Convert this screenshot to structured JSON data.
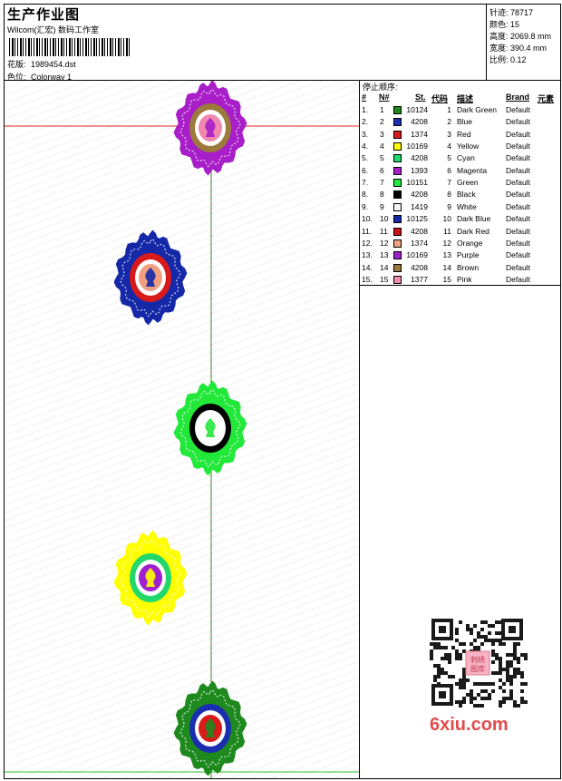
{
  "header": {
    "title": "生产作业图",
    "company": "Wilcom(汇宏) 数码工作室",
    "design_label": "花版:",
    "design_value": "1989454.dst",
    "color_label": "色位:",
    "color_value": "Colorway 1"
  },
  "stats": {
    "stitches_label": "针迹:",
    "stitches": "78717",
    "colors_label": "颜色:",
    "colors": "15",
    "height_label": "高度:",
    "height": "2069.8 mm",
    "width_label": "宽度:",
    "width": "390.4 mm",
    "ratio_label": "比例:",
    "ratio": "0.12"
  },
  "legend": {
    "title": "停止顺序:",
    "headers": [
      "#",
      "N#",
      "St.",
      "代码",
      "描述",
      "Brand",
      "元素"
    ],
    "rows": [
      {
        "idx": "1.",
        "n": "1",
        "st": "10124",
        "code": "1",
        "desc": "Dark Green",
        "brand": "Default",
        "color": "#1e8a1e"
      },
      {
        "idx": "2.",
        "n": "2",
        "st": "4208",
        "code": "2",
        "desc": "Blue",
        "brand": "Default",
        "color": "#1a2fb0"
      },
      {
        "idx": "3.",
        "n": "3",
        "st": "1374",
        "code": "3",
        "desc": "Red",
        "brand": "Default",
        "color": "#d81a1a"
      },
      {
        "idx": "4.",
        "n": "4",
        "st": "10169",
        "code": "4",
        "desc": "Yellow",
        "brand": "Default",
        "color": "#ffff00"
      },
      {
        "idx": "5.",
        "n": "5",
        "st": "4208",
        "code": "5",
        "desc": "Cyan",
        "brand": "Default",
        "color": "#22d86a"
      },
      {
        "idx": "6.",
        "n": "6",
        "st": "1393",
        "code": "6",
        "desc": "Magenta",
        "brand": "Default",
        "color": "#a81ec8"
      },
      {
        "idx": "7.",
        "n": "7",
        "st": "10151",
        "code": "7",
        "desc": "Green",
        "brand": "Default",
        "color": "#22e83a"
      },
      {
        "idx": "8.",
        "n": "8",
        "st": "4208",
        "code": "8",
        "desc": "Black",
        "brand": "Default",
        "color": "#000000"
      },
      {
        "idx": "9.",
        "n": "9",
        "st": "1419",
        "code": "9",
        "desc": "White",
        "brand": "Default",
        "color": "#f4f4f4"
      },
      {
        "idx": "10.",
        "n": "10",
        "st": "10125",
        "code": "10",
        "desc": "Dark Blue",
        "brand": "Default",
        "color": "#1428a8"
      },
      {
        "idx": "11.",
        "n": "11",
        "st": "4208",
        "code": "11",
        "desc": "Dark Red",
        "brand": "Default",
        "color": "#c81414"
      },
      {
        "idx": "12.",
        "n": "12",
        "st": "1374",
        "code": "12",
        "desc": "Orange",
        "brand": "Default",
        "color": "#f0a080"
      },
      {
        "idx": "13.",
        "n": "13",
        "st": "10169",
        "code": "13",
        "desc": "Purple",
        "brand": "Default",
        "color": "#a020d0"
      },
      {
        "idx": "14.",
        "n": "14",
        "st": "4208",
        "code": "14",
        "desc": "Brown",
        "brand": "Default",
        "color": "#9c7a3c"
      },
      {
        "idx": "15.",
        "n": "15",
        "st": "1377",
        "code": "15",
        "desc": "Pink",
        "brand": "Default",
        "color": "#f088b0"
      }
    ]
  },
  "watermark": "6xiu.com",
  "qr_stamp": "刺绣图库",
  "motif_colors": {
    "m1": [
      "#a81ec8",
      "#9c7a3c",
      "#f088b0"
    ],
    "m2": [
      "#1428a8",
      "#d81a1a",
      "#f0a080"
    ],
    "m3": [
      "#22e83a",
      "#000000",
      "#ffffff"
    ],
    "m4": [
      "#ffff00",
      "#22d86a",
      "#a020d0"
    ],
    "m5": [
      "#1e8a1e",
      "#1a2fb0",
      "#d81a1a"
    ]
  }
}
